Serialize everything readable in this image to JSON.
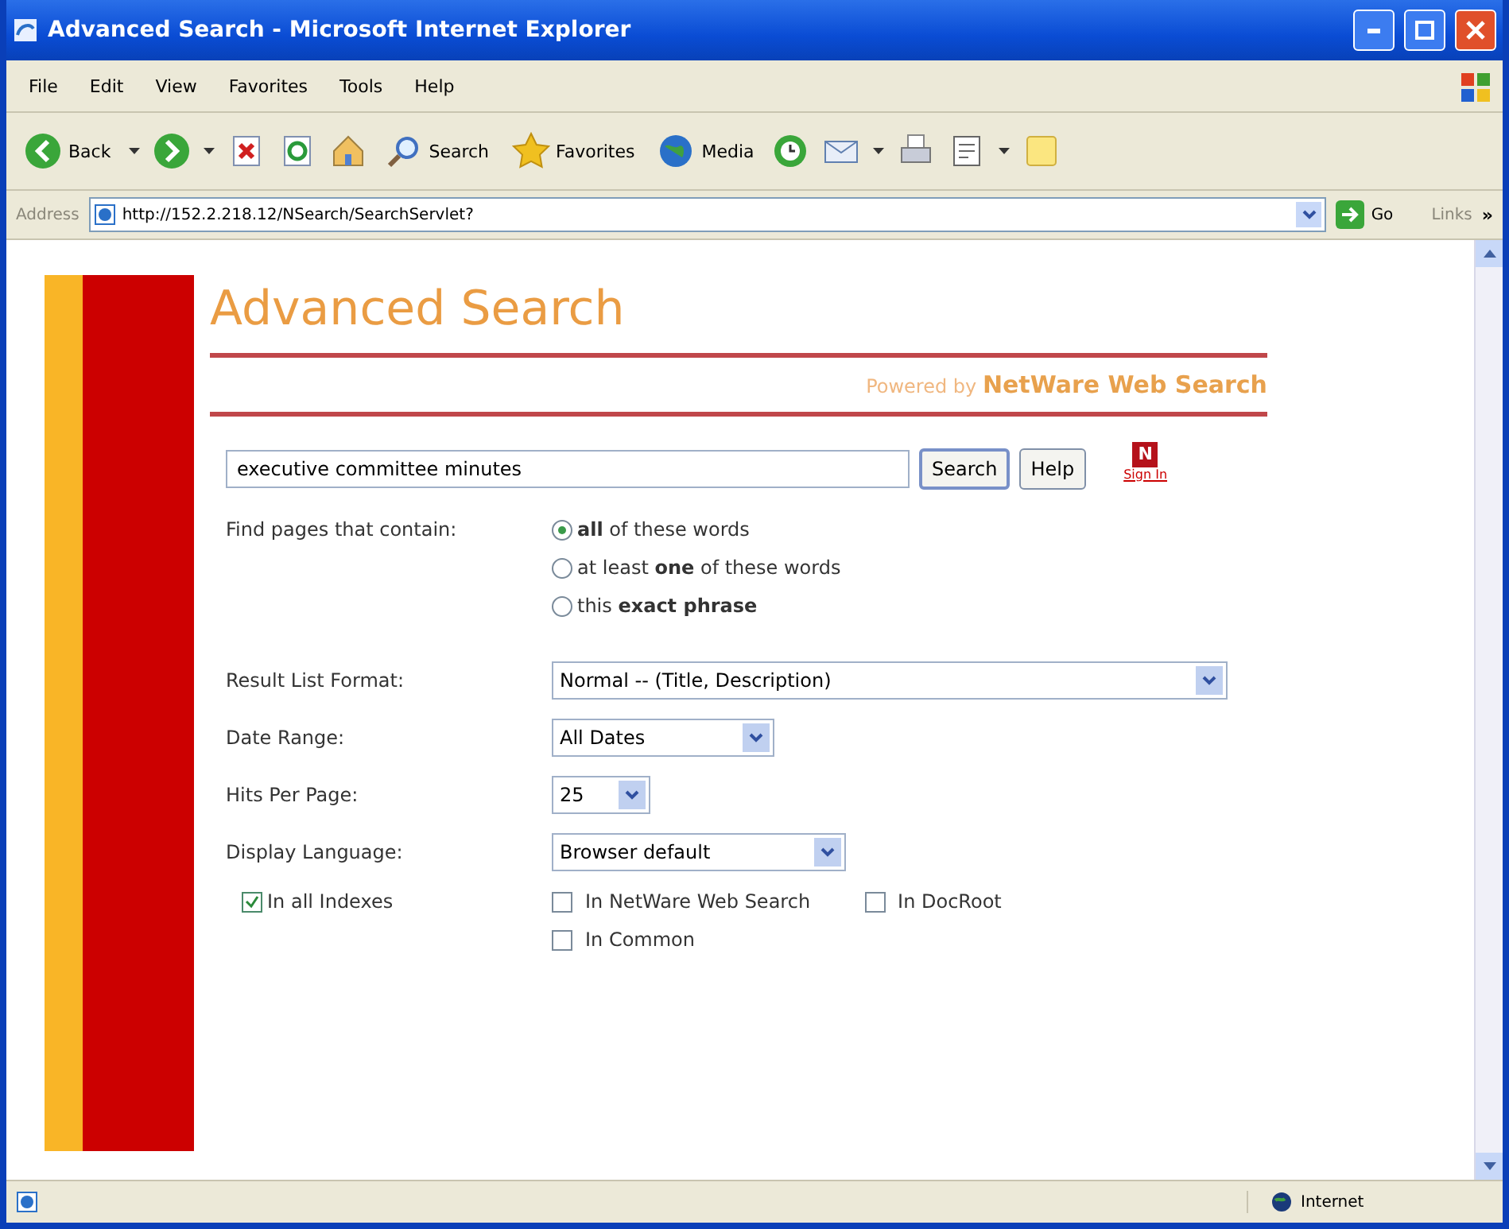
{
  "window": {
    "title": "Advanced Search - Microsoft Internet Explorer"
  },
  "menu": [
    "File",
    "Edit",
    "View",
    "Favorites",
    "Tools",
    "Help"
  ],
  "toolbar": [
    {
      "kind": "back",
      "label": "Back"
    },
    {
      "kind": "forward"
    },
    {
      "kind": "stop"
    },
    {
      "kind": "refresh"
    },
    {
      "kind": "home"
    },
    {
      "kind": "search",
      "label": "Search"
    },
    {
      "kind": "favorites",
      "label": "Favorites"
    },
    {
      "kind": "media",
      "label": "Media"
    },
    {
      "kind": "history"
    },
    {
      "kind": "mail"
    },
    {
      "kind": "print"
    },
    {
      "kind": "edit"
    },
    {
      "kind": "note"
    }
  ],
  "address": {
    "label": "Address",
    "url": "http://152.2.218.12/NSearch/SearchServlet?",
    "go": "Go",
    "links": "Links",
    "more": "»"
  },
  "page": {
    "heading": "Advanced Search",
    "powered_prefix": "Powered by",
    "powered_name": "NetWare Web Search",
    "query": "executive committee minutes",
    "search_button": "Search",
    "help_button": "Help",
    "badge": "N",
    "sign_in": "Sign In",
    "find_label": "Find pages that contain:",
    "match_options": [
      {
        "label": "**all** of these words",
        "selected": true
      },
      {
        "label": "at least **one** of these words",
        "selected": false
      },
      {
        "label": "this **exact phrase**",
        "selected": false
      }
    ],
    "selects": [
      {
        "label": "Result List Format:",
        "value": "Normal -- (Title, Description)"
      },
      {
        "label": "Date Range:",
        "value": "All Dates"
      },
      {
        "label": "Hits Per Page:",
        "value": "25"
      },
      {
        "label": "Display Language:",
        "value": "Browser default"
      }
    ],
    "all_indexes": {
      "label": "In all Indexes",
      "checked": true
    },
    "indexes": [
      {
        "label": "In NetWare Web Search",
        "checked": false
      },
      {
        "label": "In DocRoot",
        "checked": false
      },
      {
        "label": "In Common",
        "checked": false
      }
    ]
  },
  "status": {
    "zone": "Internet"
  }
}
